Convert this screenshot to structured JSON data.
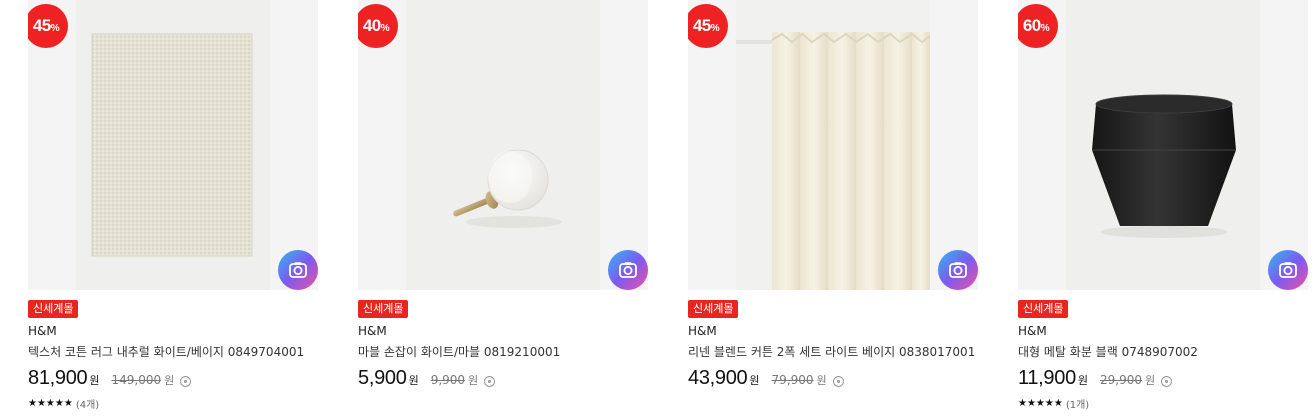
{
  "products": [
    {
      "discount": "45",
      "discount_unit": "%",
      "store": "신세계몰",
      "brand": "H&M",
      "title": "텍스처 코튼 러그 내추럴 화이트/베이지 0849704001",
      "price": "81,900",
      "currency": "원",
      "original_price": "149,000",
      "original_currency": "원",
      "stars": "★★★★★",
      "reviews": "(4개)",
      "image": "rug-photo"
    },
    {
      "discount": "40",
      "discount_unit": "%",
      "store": "신세계몰",
      "brand": "H&M",
      "title": "마블 손잡이 화이트/마블 0819210001",
      "price": "5,900",
      "currency": "원",
      "original_price": "9,900",
      "original_currency": "원",
      "image": "knob-photo"
    },
    {
      "discount": "45",
      "discount_unit": "%",
      "store": "신세계몰",
      "brand": "H&M",
      "title": "리넨 블렌드 커튼 2폭 세트 라이트 베이지 0838017001",
      "price": "43,900",
      "currency": "원",
      "original_price": "79,900",
      "original_currency": "원",
      "image": "curtain-photo"
    },
    {
      "discount": "60",
      "discount_unit": "%",
      "store": "신세계몰",
      "brand": "H&M",
      "title": "대형 메탈 화분 블랙 0748907002",
      "price": "11,900",
      "currency": "원",
      "original_price": "29,900",
      "original_currency": "원",
      "stars": "★★★★★",
      "reviews": "(1개)",
      "image": "planter-photo"
    }
  ],
  "icons": {
    "lens": "camera-lens-icon",
    "info": "info-circle-icon"
  },
  "colors": {
    "badge": "#ee2222",
    "store_tag": "#e8251f"
  }
}
